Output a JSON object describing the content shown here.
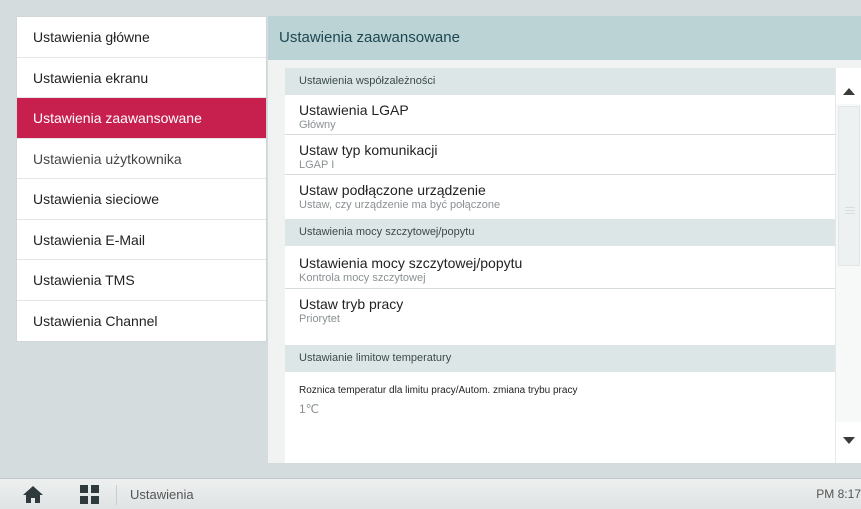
{
  "menu": {
    "items": [
      {
        "label": "Ustawienia główne"
      },
      {
        "label": "Ustawienia ekranu"
      },
      {
        "label": "Ustawienia zaawansowane"
      },
      {
        "label": "Ustawienia użytkownika"
      },
      {
        "label": "Ustawienia sieciowe"
      },
      {
        "label": "Ustawienia E-Mail"
      },
      {
        "label": "Ustawienia TMS"
      },
      {
        "label": "Ustawienia Channel"
      }
    ],
    "active_index": 2
  },
  "panel": {
    "title": "Ustawienia zaawansowane",
    "sections": [
      {
        "header": "Ustawienia współzależności",
        "rows": [
          {
            "title": "Ustawienia LGAP",
            "value": "Główny"
          },
          {
            "title": "Ustaw typ komunikacji",
            "value": "LGAP I"
          },
          {
            "title": "Ustaw podłączone urządzenie",
            "value": "Ustaw, czy urządzenie ma być połączone"
          }
        ]
      },
      {
        "header": "Ustawienia mocy szczytowej/popytu",
        "rows": [
          {
            "title": "Ustawienia mocy szczytowej/popytu",
            "value": "Kontrola mocy szczytowej"
          },
          {
            "title": "Ustaw tryb pracy",
            "value": "Priorytet"
          }
        ]
      },
      {
        "header": "Ustawianie limitow temperatury",
        "rows": [
          {
            "title": "Roznica temperatur dla  limitu pracy/Autom. zmiana trybu pracy",
            "value": "1℃"
          }
        ]
      }
    ]
  },
  "bottombar": {
    "title": "Ustawienia",
    "time": "PM 8:17"
  },
  "colors": {
    "active": "#c7204f",
    "header_bg": "#bcd3d6",
    "section_bg": "#dde6e7",
    "background": "#d5dcdd"
  },
  "icons": {
    "home": "home-icon",
    "apps": "grid-icon",
    "scroll_up": "triangle-up-icon",
    "scroll_down": "triangle-down-icon"
  }
}
